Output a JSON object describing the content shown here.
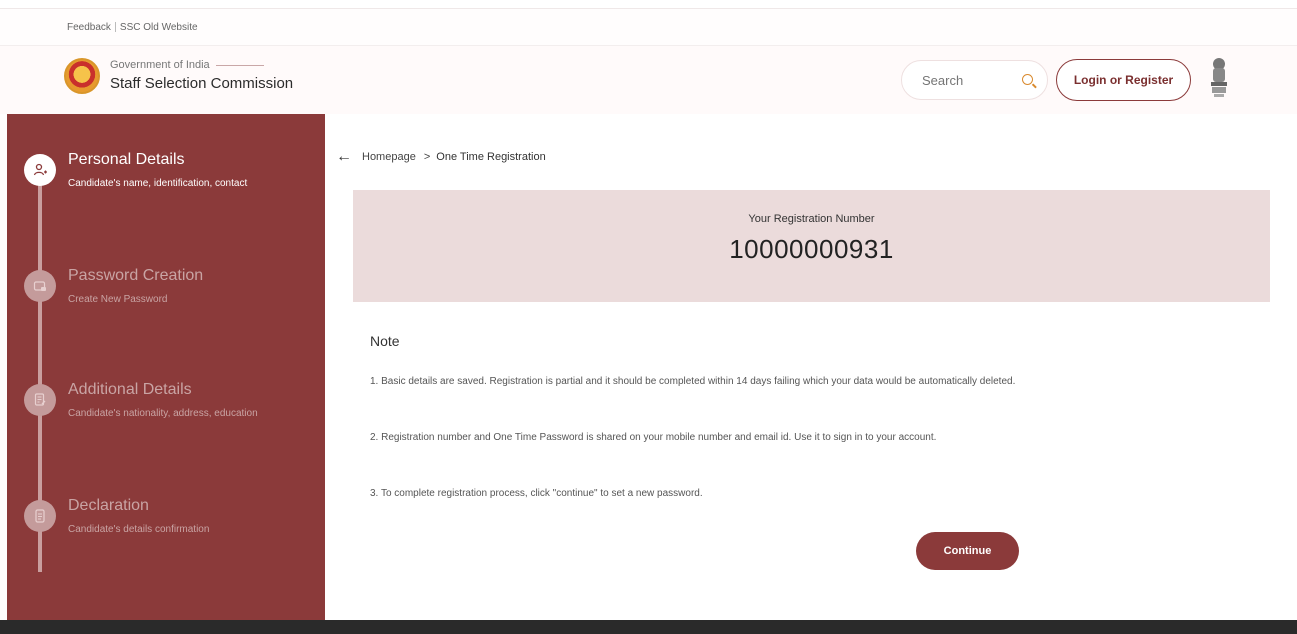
{
  "topbar": {
    "feedback": "Feedback",
    "old_site": "SSC Old Website"
  },
  "header": {
    "gov_label": "Government of India",
    "org_name": "Staff Selection Commission",
    "search_placeholder": "Search",
    "login_label": "Login or Register"
  },
  "sidebar": {
    "steps": [
      {
        "title": "Personal Details",
        "subtitle": "Candidate's name, identification, contact",
        "active": true,
        "icon": "user-add-icon"
      },
      {
        "title": "Password Creation",
        "subtitle": "Create New Password",
        "active": false,
        "icon": "password-icon"
      },
      {
        "title": "Additional Details",
        "subtitle": "Candidate's nationality, address, education",
        "active": false,
        "icon": "document-edit-icon"
      },
      {
        "title": "Declaration",
        "subtitle": "Candidate's details confirmation",
        "active": false,
        "icon": "document-icon"
      }
    ]
  },
  "breadcrumb": {
    "home": "Homepage",
    "separator": ">",
    "current": "One Time Registration"
  },
  "registration": {
    "label": "Your Registration Number",
    "number": "10000000931"
  },
  "note": {
    "title": "Note",
    "items": [
      "1. Basic details are saved. Registration is partial and it should be completed within 14 days failing which your data would be automatically deleted.",
      "2. Registration number and One Time Password is shared on your mobile number and email id. Use it to sign in to your account.",
      "3. To complete registration process, click \"continue\" to set a new password."
    ]
  },
  "continue_label": "Continue",
  "colors": {
    "brand": "#8b3a3a",
    "sidebar_inactive": "#c9a4a4",
    "highlight_box": "#ebdbdb",
    "footer": "#2a2a2a"
  }
}
